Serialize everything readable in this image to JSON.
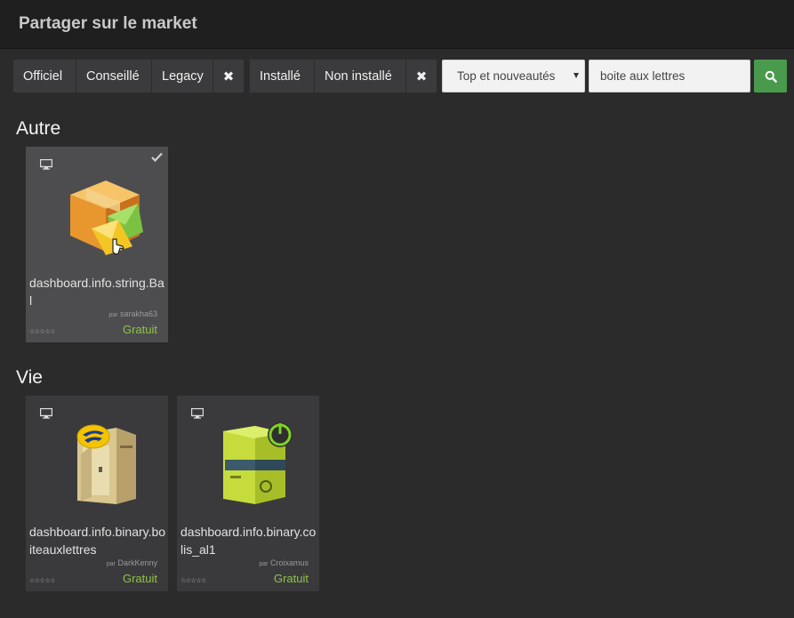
{
  "header": {
    "title": "Partager sur le market"
  },
  "filters": {
    "group1": [
      "Officiel",
      "Conseillé",
      "Legacy"
    ],
    "group2": [
      "Installé",
      "Non installé"
    ],
    "clear_glyph": "✖"
  },
  "sort": {
    "selected": "Top et nouveautés"
  },
  "search": {
    "value": "boite aux lettres"
  },
  "sections": [
    {
      "title": "Autre",
      "cards": [
        {
          "name": "dashboard.info.string.Bal",
          "author_prefix": "par",
          "author": "sarakha63",
          "price": "Gratuit",
          "stars": "☆☆☆☆☆",
          "installed": true,
          "icon": "package-mail-icon"
        }
      ]
    },
    {
      "title": "Vie",
      "cards": [
        {
          "name": "dashboard.info.binary.boiteauxlettres",
          "author_prefix": "par",
          "author": "DarkKenny",
          "price": "Gratuit",
          "stars": "☆☆☆☆☆",
          "installed": false,
          "icon": "mailbox-icon"
        },
        {
          "name": "dashboard.info.binary.colis_al1",
          "author_prefix": "par",
          "author": "Croixamus",
          "price": "Gratuit",
          "stars": "☆☆☆☆☆",
          "installed": false,
          "icon": "colissimo-box-icon"
        }
      ]
    }
  ],
  "colors": {
    "price": "#8fc349",
    "search_button": "#4a9a4e",
    "background": "#2b2b2c"
  }
}
